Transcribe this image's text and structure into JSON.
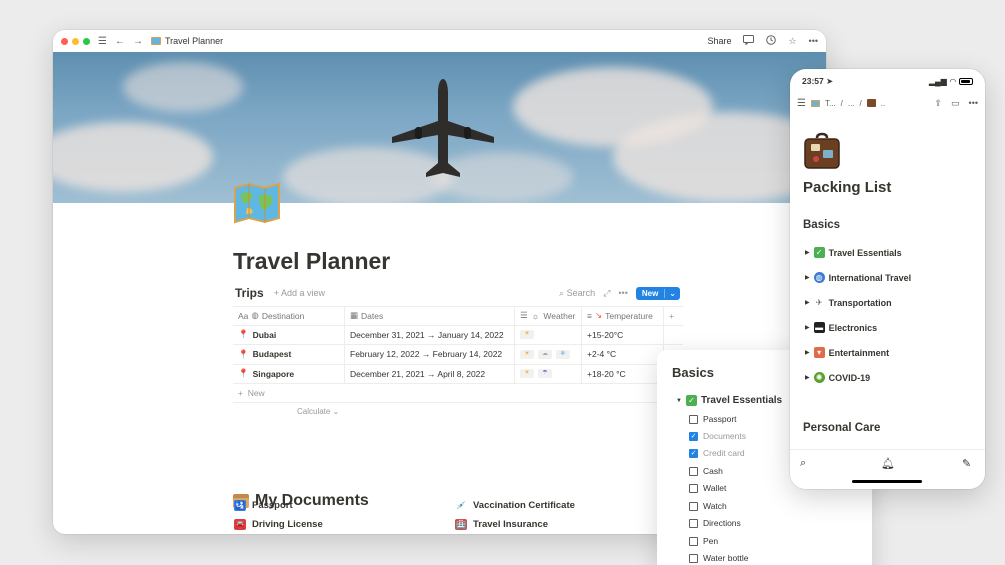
{
  "window": {
    "title": "Travel Planner",
    "share_label": "Share"
  },
  "page": {
    "title": "Travel Planner"
  },
  "trips": {
    "title": "Trips",
    "add_view": "Add a view",
    "search": "Search",
    "new_button": "New",
    "columns": [
      "Destination",
      "Dates",
      "Weather",
      "Temperature"
    ],
    "rows": [
      {
        "destination": "Dubai",
        "dates": "December 31, 2021 → January 14, 2022",
        "weather": [
          "sun"
        ],
        "temperature": "+15-20°C"
      },
      {
        "destination": "Budapest",
        "dates": "February 12, 2022 → February 14, 2022",
        "weather": [
          "sun",
          "cloud",
          "snow"
        ],
        "temperature": "+2-4 °C"
      },
      {
        "destination": "Singapore",
        "dates": "December 21, 2021 → April 8, 2022",
        "weather": [
          "sun",
          "rain"
        ],
        "temperature": "+18-20 °C"
      }
    ],
    "new_row": "New",
    "calculate": "Calculate"
  },
  "documents": {
    "title": "My Documents",
    "items": [
      {
        "label": "Passport"
      },
      {
        "label": "Vaccination Certificate"
      },
      {
        "label": "Driving License"
      },
      {
        "label": "Travel Insurance"
      }
    ]
  },
  "basics_panel": {
    "title": "Basics",
    "group": "Travel Essentials",
    "items": [
      {
        "label": "Passport",
        "checked": false
      },
      {
        "label": "Documents",
        "checked": true
      },
      {
        "label": "Credit card",
        "checked": true
      },
      {
        "label": "Cash",
        "checked": false
      },
      {
        "label": "Wallet",
        "checked": false
      },
      {
        "label": "Watch",
        "checked": false
      },
      {
        "label": "Directions",
        "checked": false
      },
      {
        "label": "Pen",
        "checked": false
      },
      {
        "label": "Water bottle",
        "checked": false
      }
    ]
  },
  "phone": {
    "time": "23:57",
    "crumb_1": "T...",
    "crumb_2": "...",
    "crumb_3": "..",
    "page_title": "Packing List",
    "section_1": "Basics",
    "items": [
      {
        "label": "Travel Essentials"
      },
      {
        "label": "International Travel"
      },
      {
        "label": "Transportation"
      },
      {
        "label": "Electronics"
      },
      {
        "label": "Entertainment"
      },
      {
        "label": "COVID-19"
      }
    ],
    "section_2": "Personal Care"
  },
  "colors": {
    "accent": "#2383e2",
    "text": "#37352f",
    "muted": "#9b9a97"
  }
}
